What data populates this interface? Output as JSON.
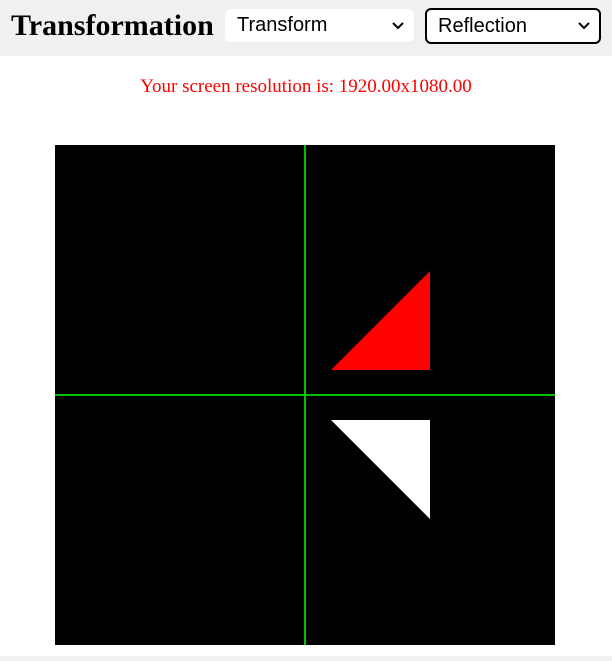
{
  "header": {
    "title": "Transformation",
    "transform_select": {
      "value": "Transform"
    },
    "mode_select": {
      "value": "Reflection"
    }
  },
  "status": {
    "resolution_text": "Your screen resolution is: 1920.00x1080.00"
  },
  "canvas": {
    "background": "#000000",
    "axis_color": "#00c000",
    "shapes": [
      {
        "name": "original-triangle",
        "color": "#ff0000"
      },
      {
        "name": "reflected-triangle",
        "color": "#ffffff"
      }
    ]
  },
  "icons": {
    "dropdown": "chevron-down-icon"
  }
}
